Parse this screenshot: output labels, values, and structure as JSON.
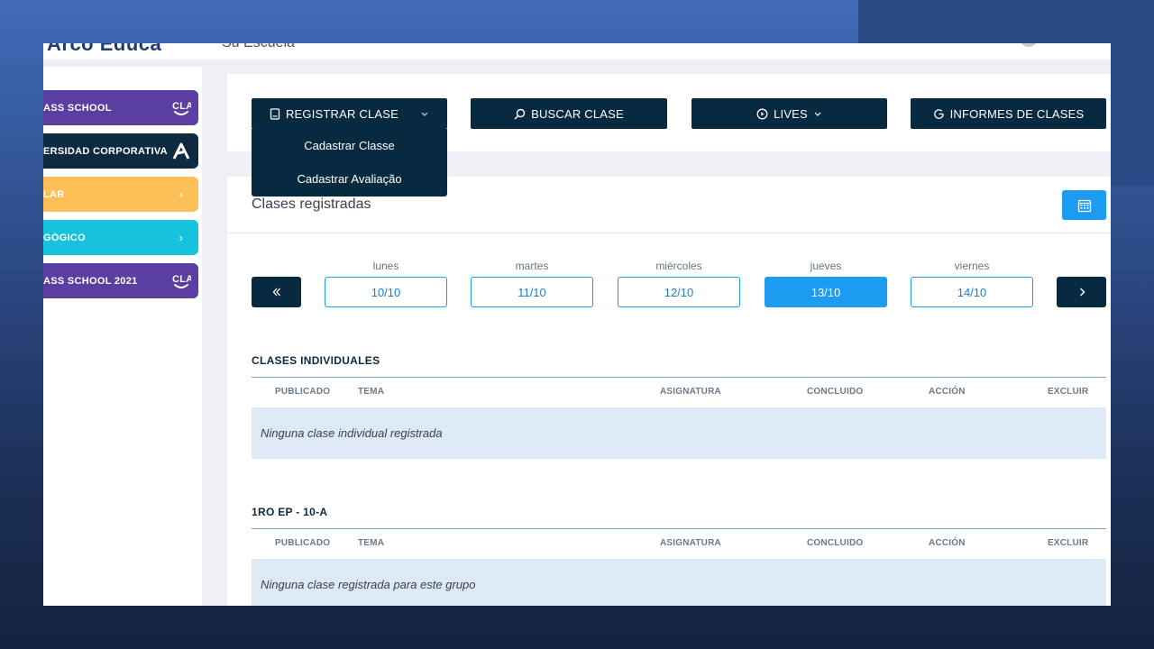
{
  "header": {
    "brand": "Arco Educa",
    "school": "Su Escuela"
  },
  "sidebar": {
    "items": [
      {
        "label": "ASS SCHOOL",
        "icon": "cla",
        "color": "#5b3fa0"
      },
      {
        "label": "ERSIDAD CORPORATIVA",
        "icon": "A",
        "color": "#0e2a40"
      },
      {
        "label": "LAR",
        "icon": "›",
        "color": "#ffbf57"
      },
      {
        "label": "GÓGICO",
        "icon": "›",
        "color": "#17c3dc"
      },
      {
        "label": "ASS SCHOOL 2021",
        "icon": "cla",
        "color": "#5b3fa0"
      }
    ]
  },
  "toolbar": {
    "registrar": "REGISTRAR CLASE",
    "buscar": "BUSCAR CLASE",
    "lives": "LIVES",
    "informes": "INFORMES DE CLASES"
  },
  "dropdown": {
    "options": [
      "Cadastrar Classe",
      "Cadastrar Avaliação"
    ]
  },
  "main": {
    "title": "Clases registradas",
    "days": [
      {
        "name": "lunes",
        "date": "10/10",
        "active": false
      },
      {
        "name": "martes",
        "date": "11/10",
        "active": false
      },
      {
        "name": "miércoles",
        "date": "12/10",
        "active": false
      },
      {
        "name": "jueves",
        "date": "13/10",
        "active": true
      },
      {
        "name": "viernes",
        "date": "14/10",
        "active": false
      }
    ],
    "columns": [
      "PUBLICADO",
      "TEMA",
      "ASIGNATURA",
      "CONCLUIDO",
      "ACCIÓN",
      "EXCLUIR"
    ],
    "groups": [
      {
        "title": "CLASES INDIVIDUALES",
        "empty": "Ninguna clase individual registrada"
      },
      {
        "title": "1RO EP - 10-A",
        "empty": "Ninguna clase registrada para este grupo"
      }
    ]
  },
  "colors": {
    "primary_dark": "#082a40",
    "accent_blue": "#1d9bf0"
  }
}
